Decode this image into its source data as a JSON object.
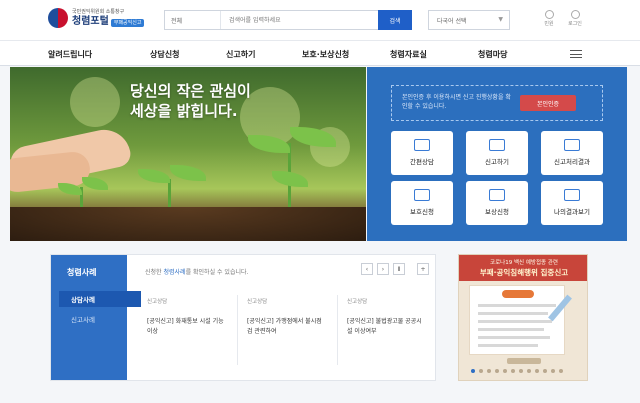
{
  "header": {
    "logo_sub": "국민권익위원회 소통창구",
    "logo_main": "청렴포털",
    "logo_badge": "부패공익신고",
    "search_select": "전체",
    "search_placeholder": "검색어를 입력하세요",
    "search_button": "검색",
    "lang_select": "다국어 선택",
    "util_items": [
      "민원",
      "로그인"
    ]
  },
  "gnb": {
    "items": [
      "알려드립니다",
      "상담신청",
      "신고하기",
      "보호·보상신청",
      "청렴자료실",
      "청렴마당"
    ]
  },
  "hero": {
    "title_line1": "당신의 작은 관심이",
    "title_line2": "세상을 밝힙니다."
  },
  "service": {
    "message": "본인인증 후 이용하시면 신고 진행상황을 확인할 수 있습니다.",
    "button": "본인인증",
    "tiles": [
      "간편상담",
      "신고하기",
      "신고처리결과",
      "보호신청",
      "보상신청",
      "나의결과보기"
    ]
  },
  "cases": {
    "title": "청렴사례",
    "tabs": [
      "상담사례",
      "신고사례"
    ],
    "hint_prefix": "신청한",
    "hint_link": "청렴사례",
    "hint_suffix": "를 확인하실 수 있습니다.",
    "controls": [
      "‹",
      "›",
      "Ⅱ",
      "+"
    ],
    "items": [
      {
        "category": "신고상담",
        "text": "[공익신고] 화재통보 시설 기능 이상"
      },
      {
        "category": "신고상담",
        "text": "[공익신고] 가맹점에서 불시점검 관련하여"
      },
      {
        "category": "신고상담",
        "text": "[공익신고] 불법광고물 공공시설 이상여부"
      }
    ]
  },
  "banner": {
    "line1": "코로나19 백신 예방접종 관련",
    "line2": "부패·공익침해행위 집중신고"
  }
}
